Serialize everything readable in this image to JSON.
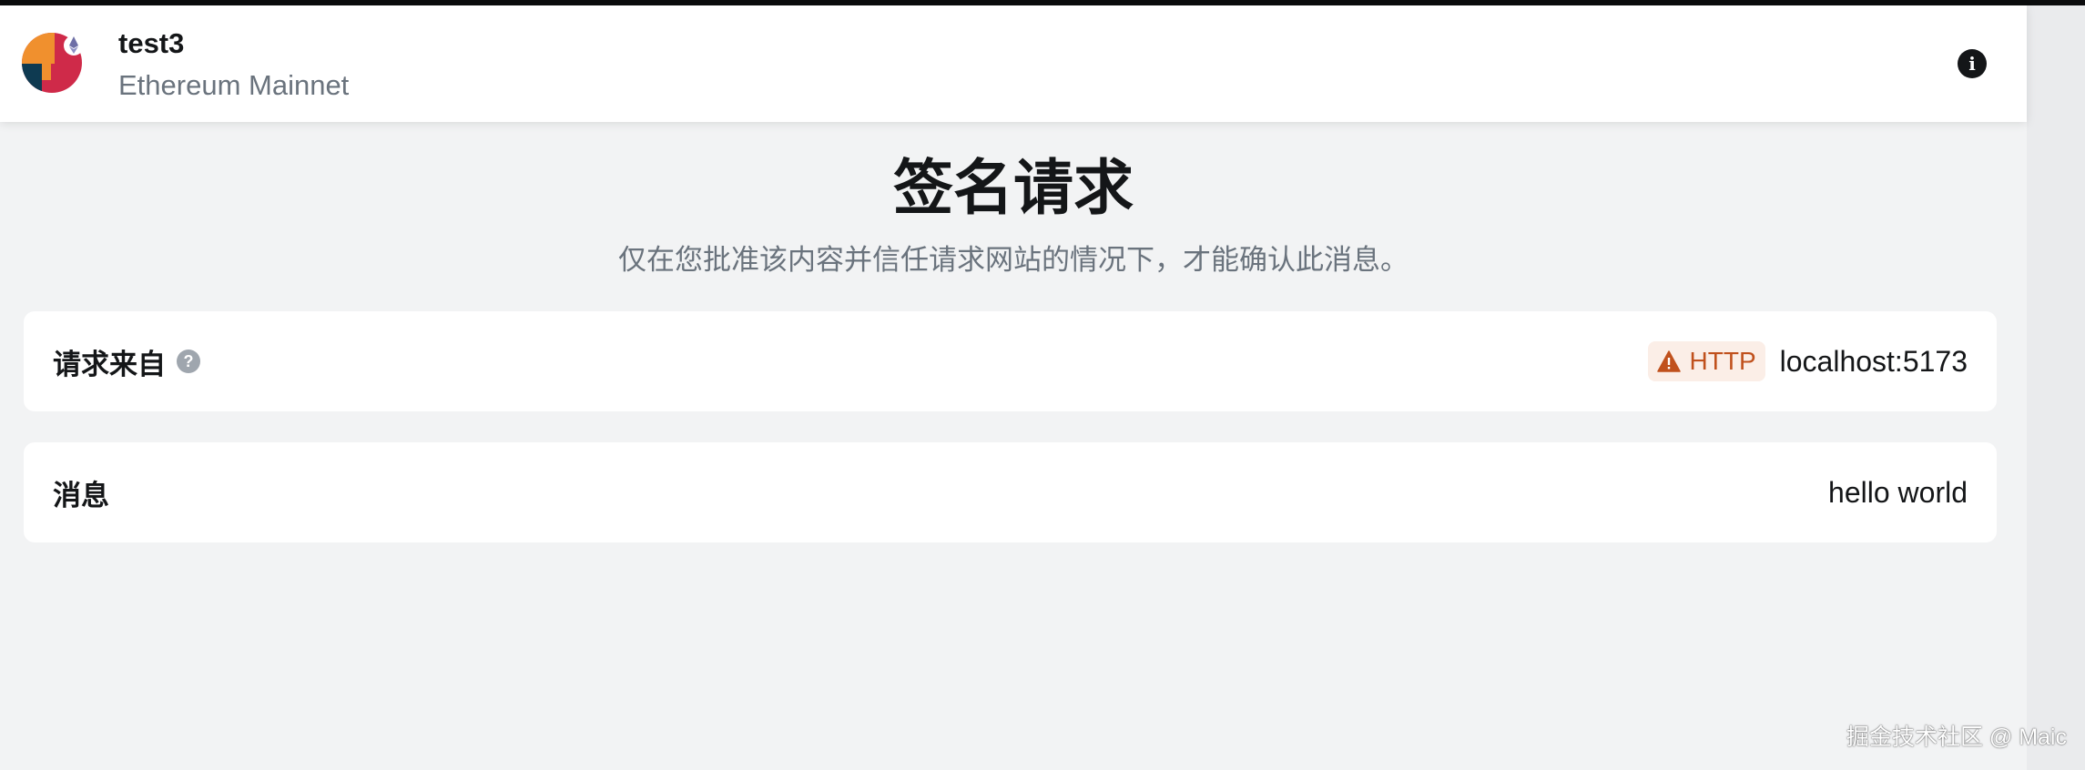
{
  "header": {
    "account_name": "test3",
    "network_name": "Ethereum Mainnet"
  },
  "page": {
    "title": "签名请求",
    "subtitle": "仅在您批准该内容并信任请求网站的情况下，才能确认此消息。"
  },
  "request_from": {
    "label": "请求来自",
    "protocol_badge": "HTTP",
    "origin": "localhost:5173"
  },
  "message": {
    "label": "消息",
    "value": "hello world"
  },
  "watermark": "掘金技术社区 @ Maic",
  "colors": {
    "warning": "#c0511d",
    "warning_bg": "#fbeee7",
    "background": "#f2f3f4"
  }
}
